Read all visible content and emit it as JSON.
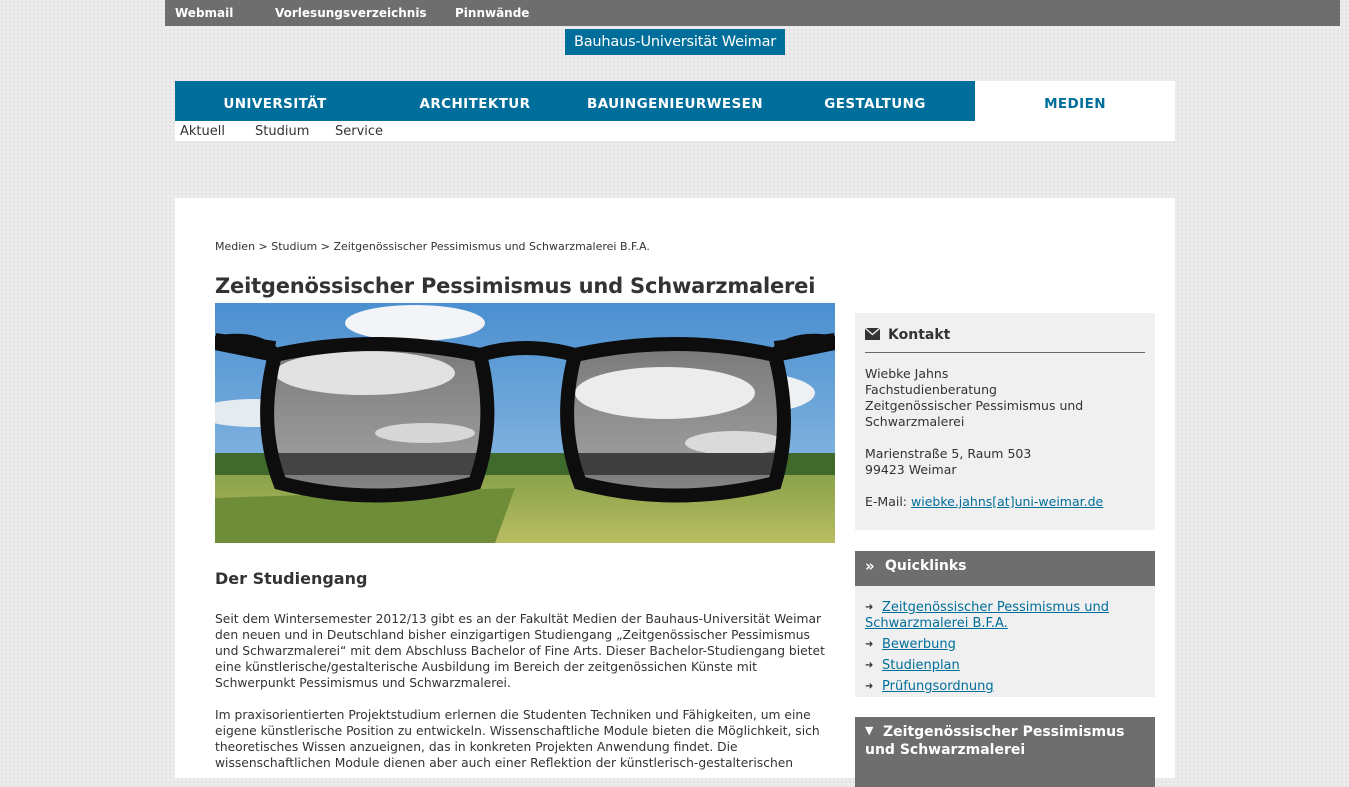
{
  "topbar": {
    "links": [
      "Webmail",
      "Vorlesungsverzeichnis",
      "Pinnwände"
    ]
  },
  "logo": "Bauhaus-Universität Weimar",
  "mainnav": {
    "items": [
      "UNIVERSITÄT",
      "ARCHITEKTUR",
      "BAUINGENIEURWESEN",
      "GESTALTUNG",
      "MEDIEN"
    ],
    "active": "MEDIEN"
  },
  "subnav": [
    "Aktuell",
    "Studium",
    "Service"
  ],
  "breadcrumb": {
    "items": [
      "Medien",
      "Studium",
      "Zeitgenössischer Pessimismus und Schwarzmalerei B.F.A."
    ],
    "separator": ">"
  },
  "page": {
    "title": "Zeitgenössischer Pessimismus und Schwarzmalerei",
    "section_title": "Der Studiengang",
    "paragraphs": [
      [
        "Seit dem Wintersemester 2012/13 gibt es an der Fakultät Medien der Bauhaus-Universität Weimar",
        "den neuen und in Deutschland bisher einzigartigen Studiengang „Zeitgenössischer Pessimismus",
        "und Schwarzmalerei“ mit dem Abschluss Bachelor of Fine Arts. Dieser Bachelor-Studiengang bietet",
        "eine künstlerische/gestalterische Ausbildung im Bereich der zeitgenössichen Künste mit",
        "Schwerpunkt Pessimismus und Schwarzmalerei."
      ],
      [
        "Im praxisorientierten Projektstudium erlernen die Studenten Techniken und Fähigkeiten, um eine",
        "eigene künstlerische Position zu entwickeln. Wissenschaftliche Module bieten die Möglichkeit, sich",
        "theoretisches Wissen anzueignen, das in konkreten Projekten Anwendung findet. Die",
        "wissenschaftlichen Module dienen aber auch einer Reflektion der künstlerisch-gestalterischen"
      ]
    ]
  },
  "kontakt": {
    "title": "Kontakt",
    "icon": "envelope-icon",
    "lines": [
      "Wiebke Jahns",
      "Fachstudienberatung",
      "Zeitgenössischer Pessimismus und",
      "Schwarzmalerei"
    ],
    "address": [
      "Marienstraße 5, Raum 503",
      "99423 Weimar"
    ],
    "email_label": "E-Mail:",
    "email": "wiebke.jahns[at]uni-weimar.de"
  },
  "quicklinks": {
    "title": "Quicklinks",
    "icon": "double-chevron-icon",
    "links": [
      [
        "Zeitgenössischer Pessimismus und",
        "Schwarzmalerei B.F.A."
      ],
      [
        "Bewerbung"
      ],
      [
        "Studienplan"
      ],
      [
        "Prüfungsordnung"
      ]
    ]
  },
  "programbox": {
    "icon": "triangle-down-icon",
    "lines": [
      "Zeitgenössischer Pessimismus",
      "und Schwarzmalerei"
    ]
  },
  "colors": {
    "brand": "#006e9a",
    "topbar": "#6e6e6e",
    "sidebox": "#f0f0f0"
  }
}
